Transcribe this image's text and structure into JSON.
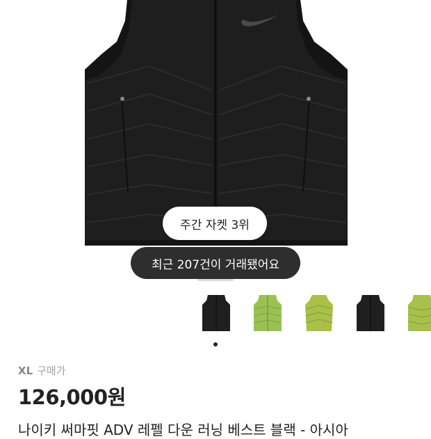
{
  "hero": {
    "rank_badge": "주간 자켓 3위",
    "trade_badge": "최근 207건이 거래됐어요"
  },
  "thumbnails": [
    {
      "color": "#1f1f1f",
      "name": "vest-black-front"
    },
    {
      "color": "#9bc155",
      "name": "vest-green-front"
    },
    {
      "color": "#a9c04a",
      "name": "vest-green-angle"
    },
    {
      "color": "#1f1f1f",
      "name": "vest-black-angle"
    },
    {
      "color": "#a8c04c",
      "name": "vest-green-back"
    }
  ],
  "product": {
    "size": "XL",
    "buy_label": "구매가",
    "price": "126,000원",
    "title": "나이키 써마핏 ADV 레펠 다운 러닝 베스트 블랙 - 아시아"
  },
  "colors": {
    "dark_pill": "#2e2e2e",
    "text": "#222222",
    "muted": "#a0a0a0"
  }
}
